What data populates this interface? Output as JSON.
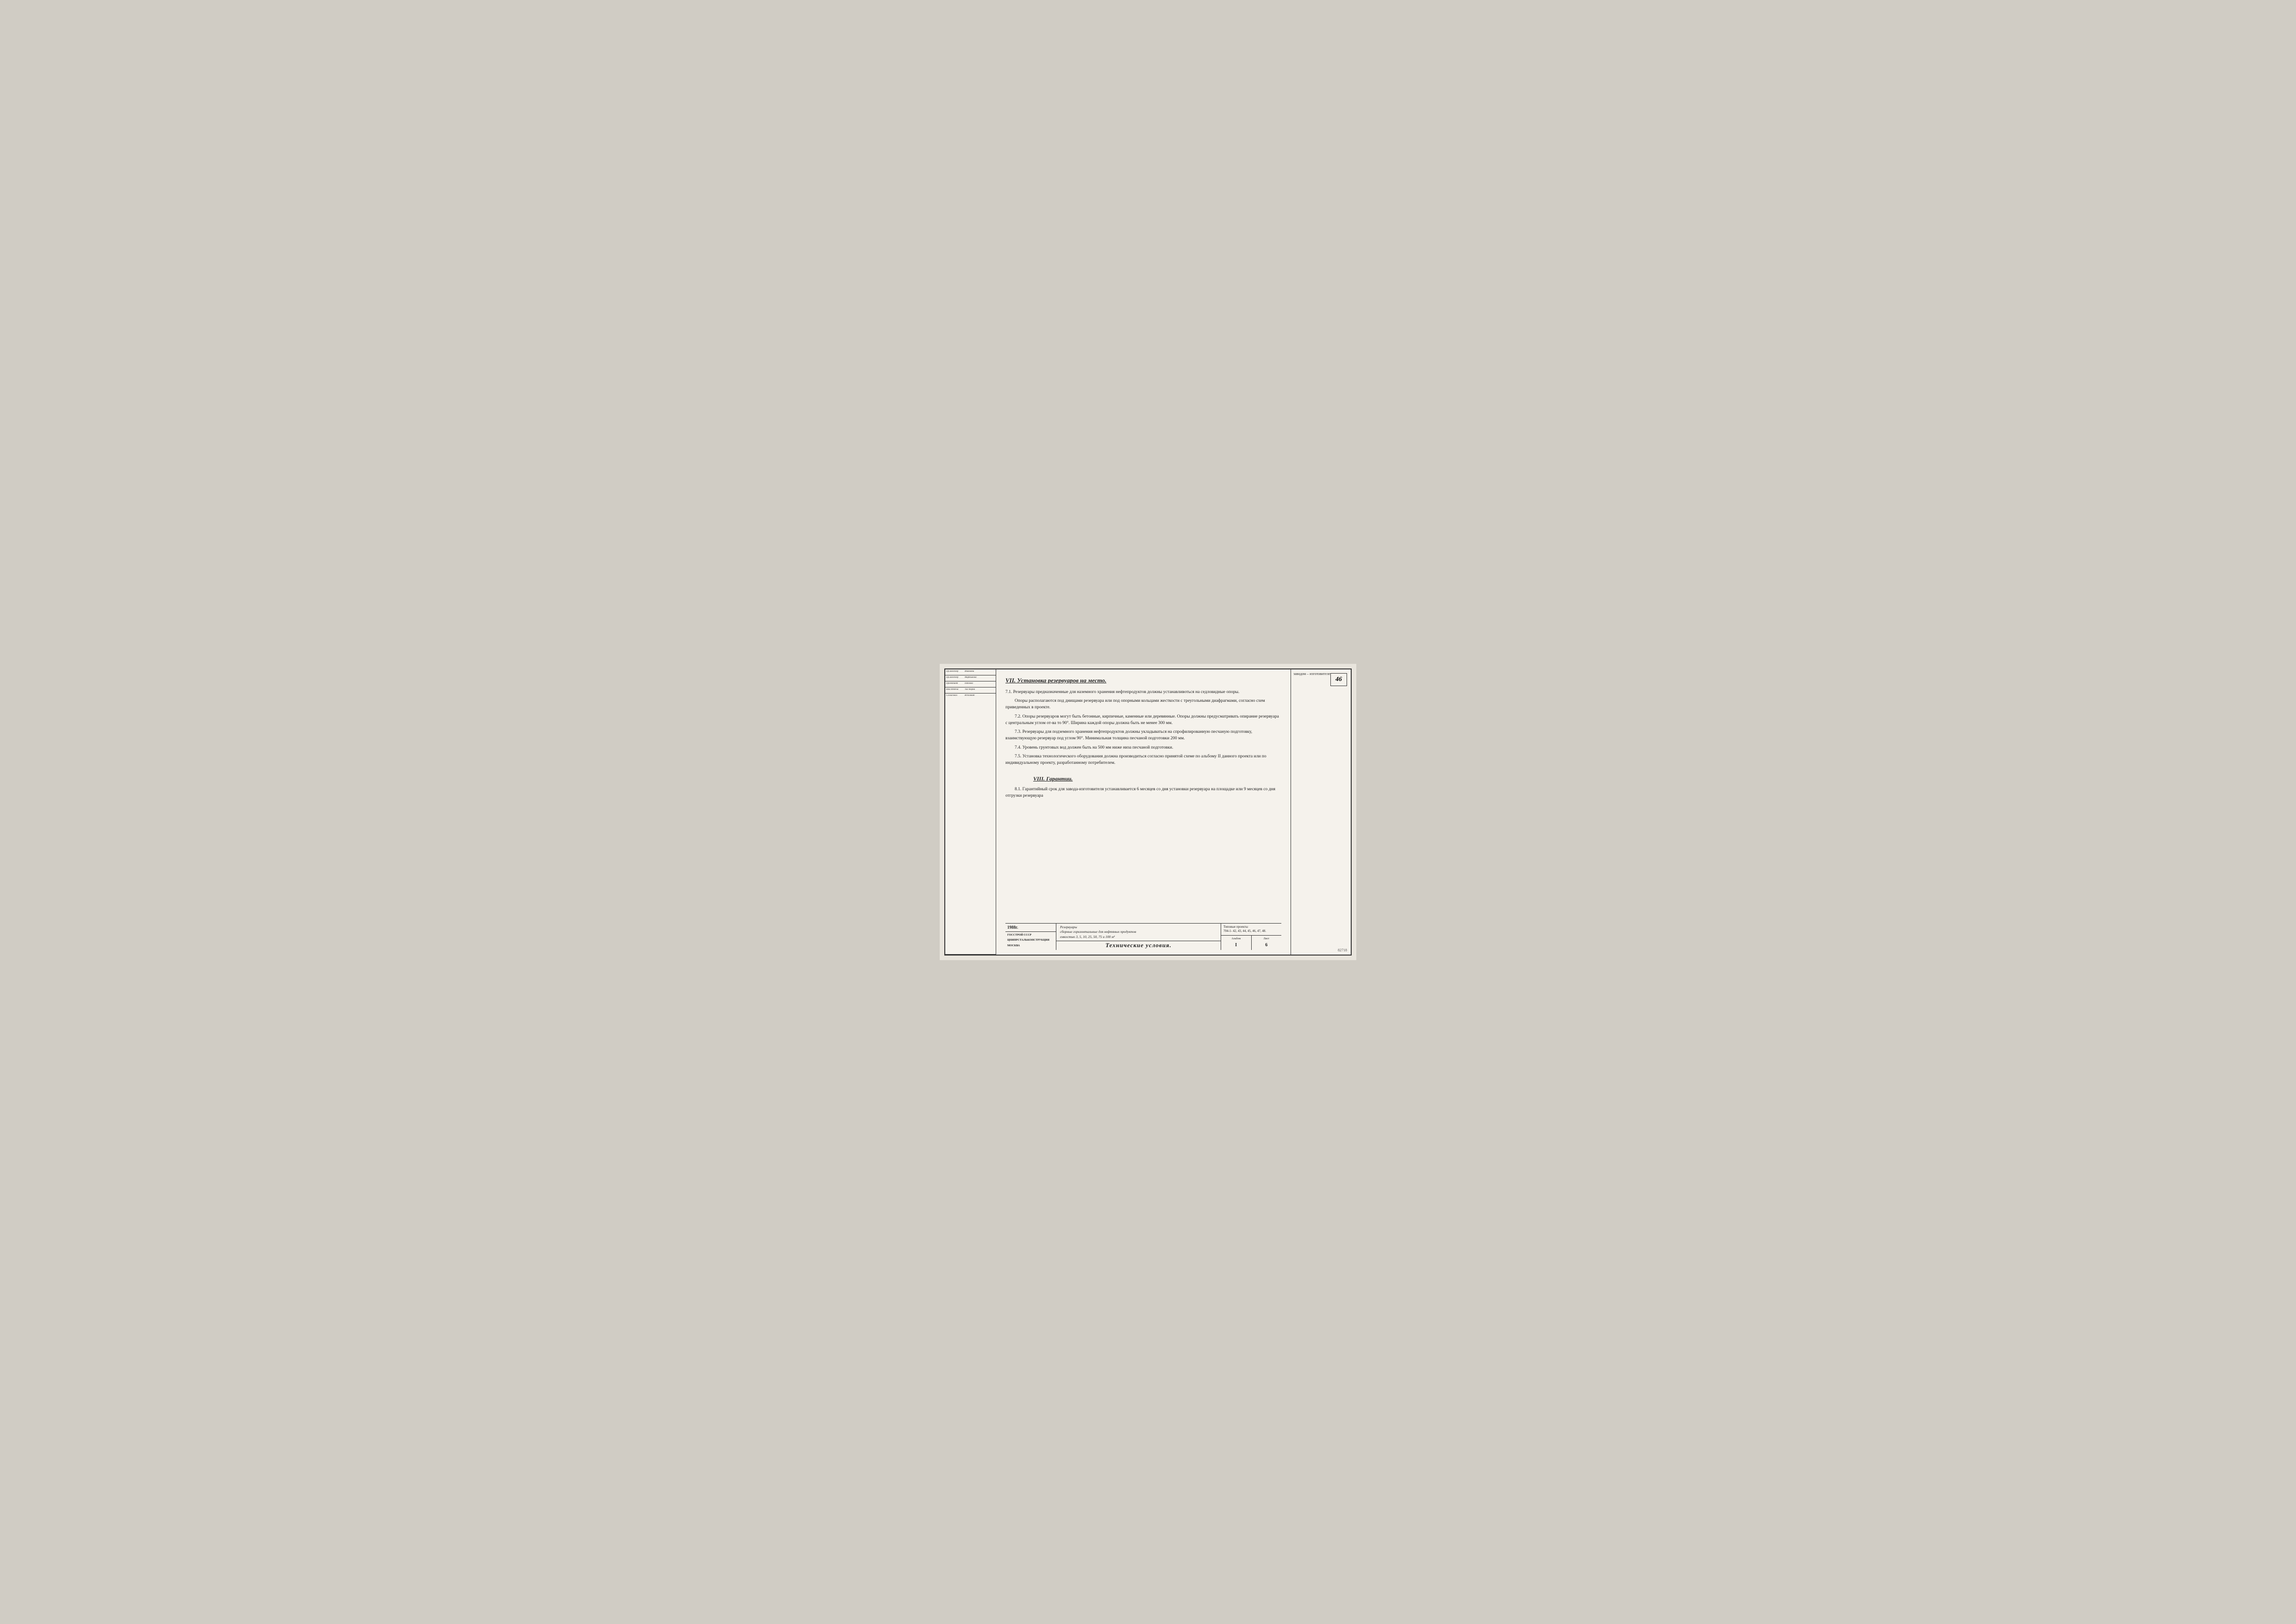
{
  "page": {
    "corner_number": "46",
    "doc_number": "82718"
  },
  "header": {
    "right_text": "заводом – изготовителем."
  },
  "section7": {
    "title": "VII. Установка резервуаров на место.",
    "para_7_1": "7.1.   Резервуары предназначенные для наземного хранения нефтепродуктов должны устанавливоться на седловидные опоры.",
    "para_7_1b": "Опоры располагаются под днищами резервуара или под опорными кольцами жесткости с треугольными диафрагмами, согласно схем приведенных в проекте.",
    "para_7_2": "7.2.   Опоры резервуаров могут быть бетонные, кирпичные, каменные или деревянные. Опоры должны предусматривать опирание резервуара с центральным углом от-ва то 90°. Ширина каждой опоры должна быть не менее 300 мм.",
    "para_7_3": "7.3.   Резервуары для подземного хранения нефтепродуктов должны укладываться на спрофилированную песчаную подготовку, взаимствующую резервуар под углом 90°. Минимальная толщина песчаной подготовки 200 мм.",
    "para_7_4": "7.4.   Уровень грунтовых вод должен быть на 500 мм ниже низа песчаной подготовки.",
    "para_7_5": "7.5.   Установка технологического оборудования должна производиться согласно принятой схеме по альбому II данного проекта или по индивидуальному проекту, разработанному потребителем."
  },
  "section8": {
    "title": "VIII.  Гарантии.",
    "para_8_1": "8.1.   Гарантийный срок для завода-изготовителя устанавливается 6 месяцев со дня установки резервуара на площадке или 9 месяцев со дня отгрузки резервуара"
  },
  "bottom_block": {
    "year": "1988г.",
    "org_line1": "ГОССТРОЙ СССР",
    "org_line2": "ЦНИПРСТАЛЬКОНСТРУКЦИЯ",
    "org_line3": "МОСКВА",
    "product_line1": "Резервуары",
    "product_line2": "сборные горизонтальные для нефтяных продуктов",
    "product_line3": "емкостью 3, 5, 10, 25, 50, 75 и 100 м³",
    "center_title": "Технические условия.",
    "right_label": "Типовые проекты",
    "right_numbers": "704-1- 42, 43, 44, 45, 46, 47, 48.",
    "album_label": "Альбом",
    "album_value": "I",
    "list_label": "Лист",
    "list_value": "6"
  },
  "sidebar": {
    "roles": [
      "Пр.инженер",
      "Пр.инженер",
      "Проектант",
      "Нач.Отдела",
      "Согласовал"
    ],
    "names": [
      "Ивановна",
      "Мартынова",
      "Паблова",
      "Тил Норна",
      "Исполнит"
    ]
  }
}
